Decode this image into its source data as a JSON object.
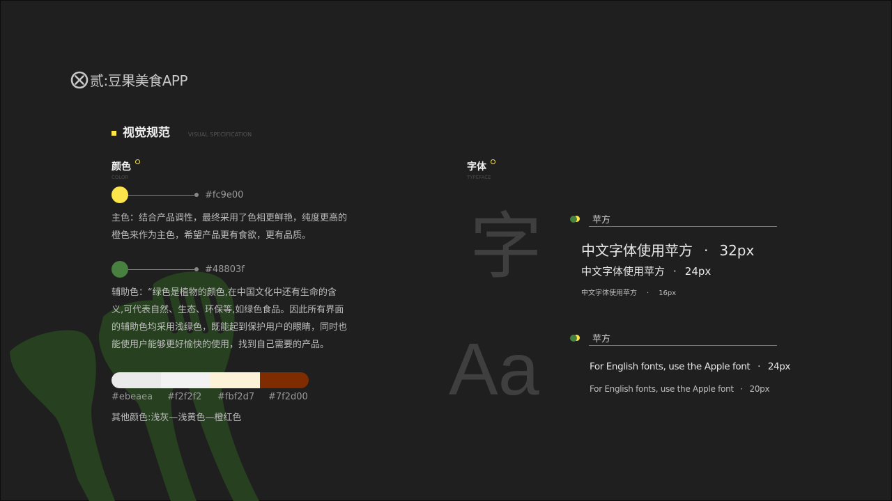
{
  "colors": {
    "background": "#1f1f1f",
    "accent": "#fce54a",
    "green": "#48803f",
    "utensil": "#27401f"
  },
  "header": {
    "icon": "x-circle-icon",
    "title": "贰:豆果美食APP"
  },
  "section": {
    "title": "视觉规范",
    "subtitle": "VISUAL SPECIFICATION"
  },
  "color_block": {
    "label": "颜色",
    "sublabel": "COLOR",
    "primary": {
      "hex": "#fc9e00",
      "swatch": "#fce54a",
      "desc_lines": [
        "主色：结合产品调性，最终采用了色相更鲜艳，纯度更高的",
        "橙色来作为主色，希望产品更有食欲，更有品质。"
      ]
    },
    "secondary": {
      "hex": "#48803f",
      "swatch": "#48803f",
      "desc_lines": [
        "辅助色：“绿色是植物的颜色,在中国文化中还有生命的含",
        "义,可代表自然、生态、环保等,如绿色食品。因此所有界面",
        "的辅助色均采用浅绿色，既能起到保护用户的眼睛，同时也",
        "能使用户能够更好愉快的使用，找到自己需要的产品。"
      ]
    },
    "others": [
      {
        "hex": "#ebeaea",
        "color": "#ebeaea"
      },
      {
        "hex": "#f2f2f2",
        "color": "#f2f2f2"
      },
      {
        "hex": "#fbf2d7",
        "color": "#fbf2d7"
      },
      {
        "hex": "#7f2d00",
        "color": "#7f2d00"
      }
    ],
    "others_caption": "其他颜色:浅灰—浅黄色—橙红色"
  },
  "type_block": {
    "label": "字体",
    "sublabel": "TYPEFACE",
    "glyph_cn": "字",
    "glyph_en": "Aa",
    "chinese": {
      "font": "苹方",
      "samples": [
        {
          "text": "中文字体使用苹方",
          "sep": "·",
          "size": "32px"
        },
        {
          "text": "中文字体使用苹方",
          "sep": "·",
          "size": "24px"
        },
        {
          "text": "中文字体使用苹方",
          "sep": "·",
          "size": "16px"
        }
      ]
    },
    "english": {
      "font": "苹方",
      "samples": [
        {
          "text": "For English fonts, use the Apple font",
          "sep": "·",
          "size": "24px"
        },
        {
          "text": "For English fonts, use the Apple font",
          "sep": "·",
          "size": "20px"
        }
      ]
    }
  }
}
